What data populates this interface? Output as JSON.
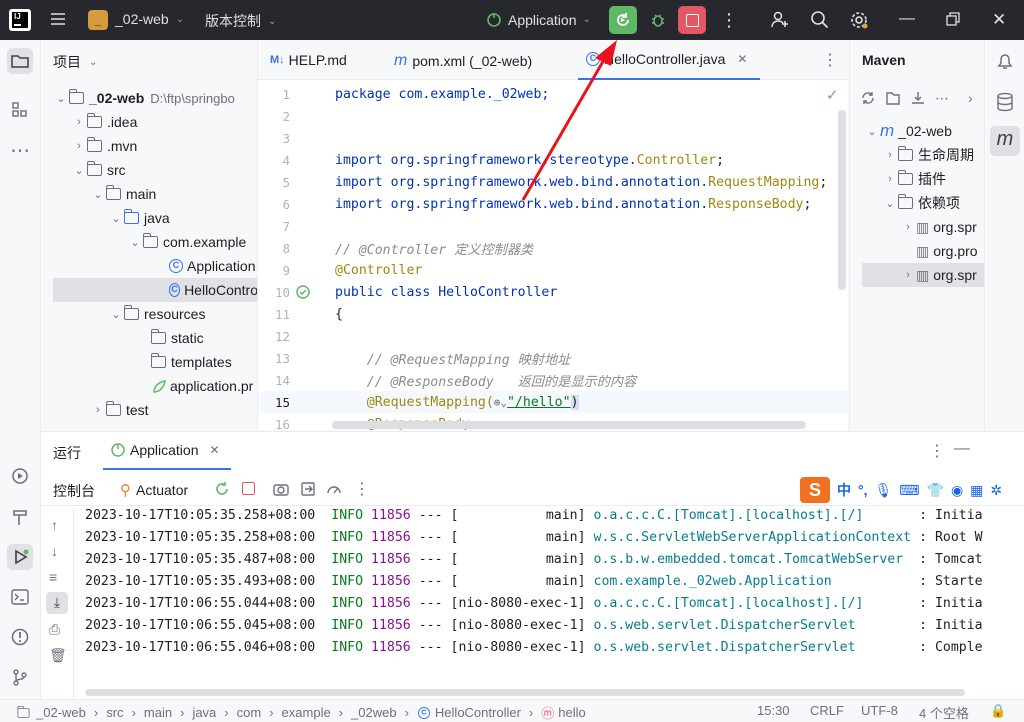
{
  "titlebar": {
    "project_name": "_02-web",
    "project_badge": "_",
    "vcs_label": "版本控制",
    "run_config": "Application"
  },
  "project_panel": {
    "title": "项目",
    "tree": [
      {
        "label": "_02-web",
        "path": "D:\\ftp\\springbo"
      },
      {
        "label": ".idea"
      },
      {
        "label": ".mvn"
      },
      {
        "label": "src"
      },
      {
        "label": "main"
      },
      {
        "label": "java"
      },
      {
        "label": "com.example"
      },
      {
        "label": "Application"
      },
      {
        "label": "HelloContro"
      },
      {
        "label": "resources"
      },
      {
        "label": "static"
      },
      {
        "label": "templates"
      },
      {
        "label": "application.pr"
      },
      {
        "label": "test"
      }
    ]
  },
  "editor": {
    "tabs": [
      {
        "label": "HELP.md",
        "icon": "M↓"
      },
      {
        "label": "pom.xml (_02-web)",
        "icon": "m"
      },
      {
        "label": "HelloController.java",
        "icon": "C"
      }
    ],
    "lines": [
      {
        "n": "1",
        "text": "package com.example._02web;"
      },
      {
        "n": "2",
        "text": ""
      },
      {
        "n": "3",
        "text": ""
      },
      {
        "n": "4",
        "text": "import org.springframework.stereotype.",
        "ann": "Controller",
        "tail": ";"
      },
      {
        "n": "5",
        "text": "import org.springframework.web.bind.annotation.",
        "ann": "RequestMapping",
        "tail": ";"
      },
      {
        "n": "6",
        "text": "import org.springframework.web.bind.annotation.",
        "ann": "ResponseBody",
        "tail": ";"
      },
      {
        "n": "7",
        "text": ""
      },
      {
        "n": "8",
        "comment": "// @Controller 定义控制器类"
      },
      {
        "n": "9",
        "annotation": "@Controller"
      },
      {
        "n": "10",
        "text": "public class HelloController"
      },
      {
        "n": "11",
        "text": "{"
      },
      {
        "n": "12",
        "text": ""
      },
      {
        "n": "13",
        "comment": "    // @RequestMapping 映射地址"
      },
      {
        "n": "14",
        "comment": "    // @ResponseBody   返回的是显示的内容"
      },
      {
        "n": "15",
        "annotation": "    @RequestMapping(",
        "string": "\"/hello\"",
        "tail": ")"
      },
      {
        "n": "16",
        "annotation": "    @ResponseBody"
      }
    ]
  },
  "maven_panel": {
    "title": "Maven",
    "tree": [
      {
        "label": "_02-web"
      },
      {
        "label": "生命周期"
      },
      {
        "label": "插件"
      },
      {
        "label": "依赖项"
      },
      {
        "label": "org.spr"
      },
      {
        "label": "org.pro"
      },
      {
        "label": "org.spr"
      }
    ]
  },
  "run_panel": {
    "title": "运行",
    "tab": "Application",
    "subtabs": [
      "控制台",
      "Actuator"
    ],
    "log": [
      {
        "ts": "2023-10-17T10:05:35.258+08:00",
        "level": "INFO",
        "pid": "11856",
        "sep": "---",
        "thread": "[           main]",
        "logger": "o.a.c.c.C.[Tomcat].[localhost].[/]      ",
        "msg": " : Initia"
      },
      {
        "ts": "2023-10-17T10:05:35.258+08:00",
        "level": "INFO",
        "pid": "11856",
        "sep": "---",
        "thread": "[           main]",
        "logger": "w.s.c.ServletWebServerApplicationContext",
        "msg": " : Root W"
      },
      {
        "ts": "2023-10-17T10:05:35.487+08:00",
        "level": "INFO",
        "pid": "11856",
        "sep": "---",
        "thread": "[           main]",
        "logger": "o.s.b.w.embedded.tomcat.TomcatWebServer ",
        "msg": " : Tomcat"
      },
      {
        "ts": "2023-10-17T10:05:35.493+08:00",
        "level": "INFO",
        "pid": "11856",
        "sep": "---",
        "thread": "[           main]",
        "logger": "com.example._02web.Application          ",
        "msg": " : Starte"
      },
      {
        "ts": "2023-10-17T10:06:55.044+08:00",
        "level": "INFO",
        "pid": "11856",
        "sep": "---",
        "thread": "[nio-8080-exec-1]",
        "logger": "o.a.c.c.C.[Tomcat].[localhost].[/]      ",
        "msg": " : Initia"
      },
      {
        "ts": "2023-10-17T10:06:55.045+08:00",
        "level": "INFO",
        "pid": "11856",
        "sep": "---",
        "thread": "[nio-8080-exec-1]",
        "logger": "o.s.web.servlet.DispatcherServlet       ",
        "msg": " : Initia"
      },
      {
        "ts": "2023-10-17T10:06:55.046+08:00",
        "level": "INFO",
        "pid": "11856",
        "sep": "---",
        "thread": "[nio-8080-exec-1]",
        "logger": "o.s.web.servlet.DispatcherServlet       ",
        "msg": " : Comple"
      }
    ]
  },
  "ime_toolbar": {
    "lang": "中",
    "punct": "°,"
  },
  "statusbar": {
    "breadcrumbs": [
      "_02-web",
      "src",
      "main",
      "java",
      "com",
      "example",
      "_02web",
      "HelloController",
      "hello"
    ],
    "position": "15:30",
    "line_sep": "CRLF",
    "encoding": "UTF-8",
    "indent": "4 个空格"
  },
  "colors": {
    "run_button": "#5fb865",
    "stop_button": "#e55765",
    "arrow": "#e8141c",
    "accent": "#3574f0"
  }
}
